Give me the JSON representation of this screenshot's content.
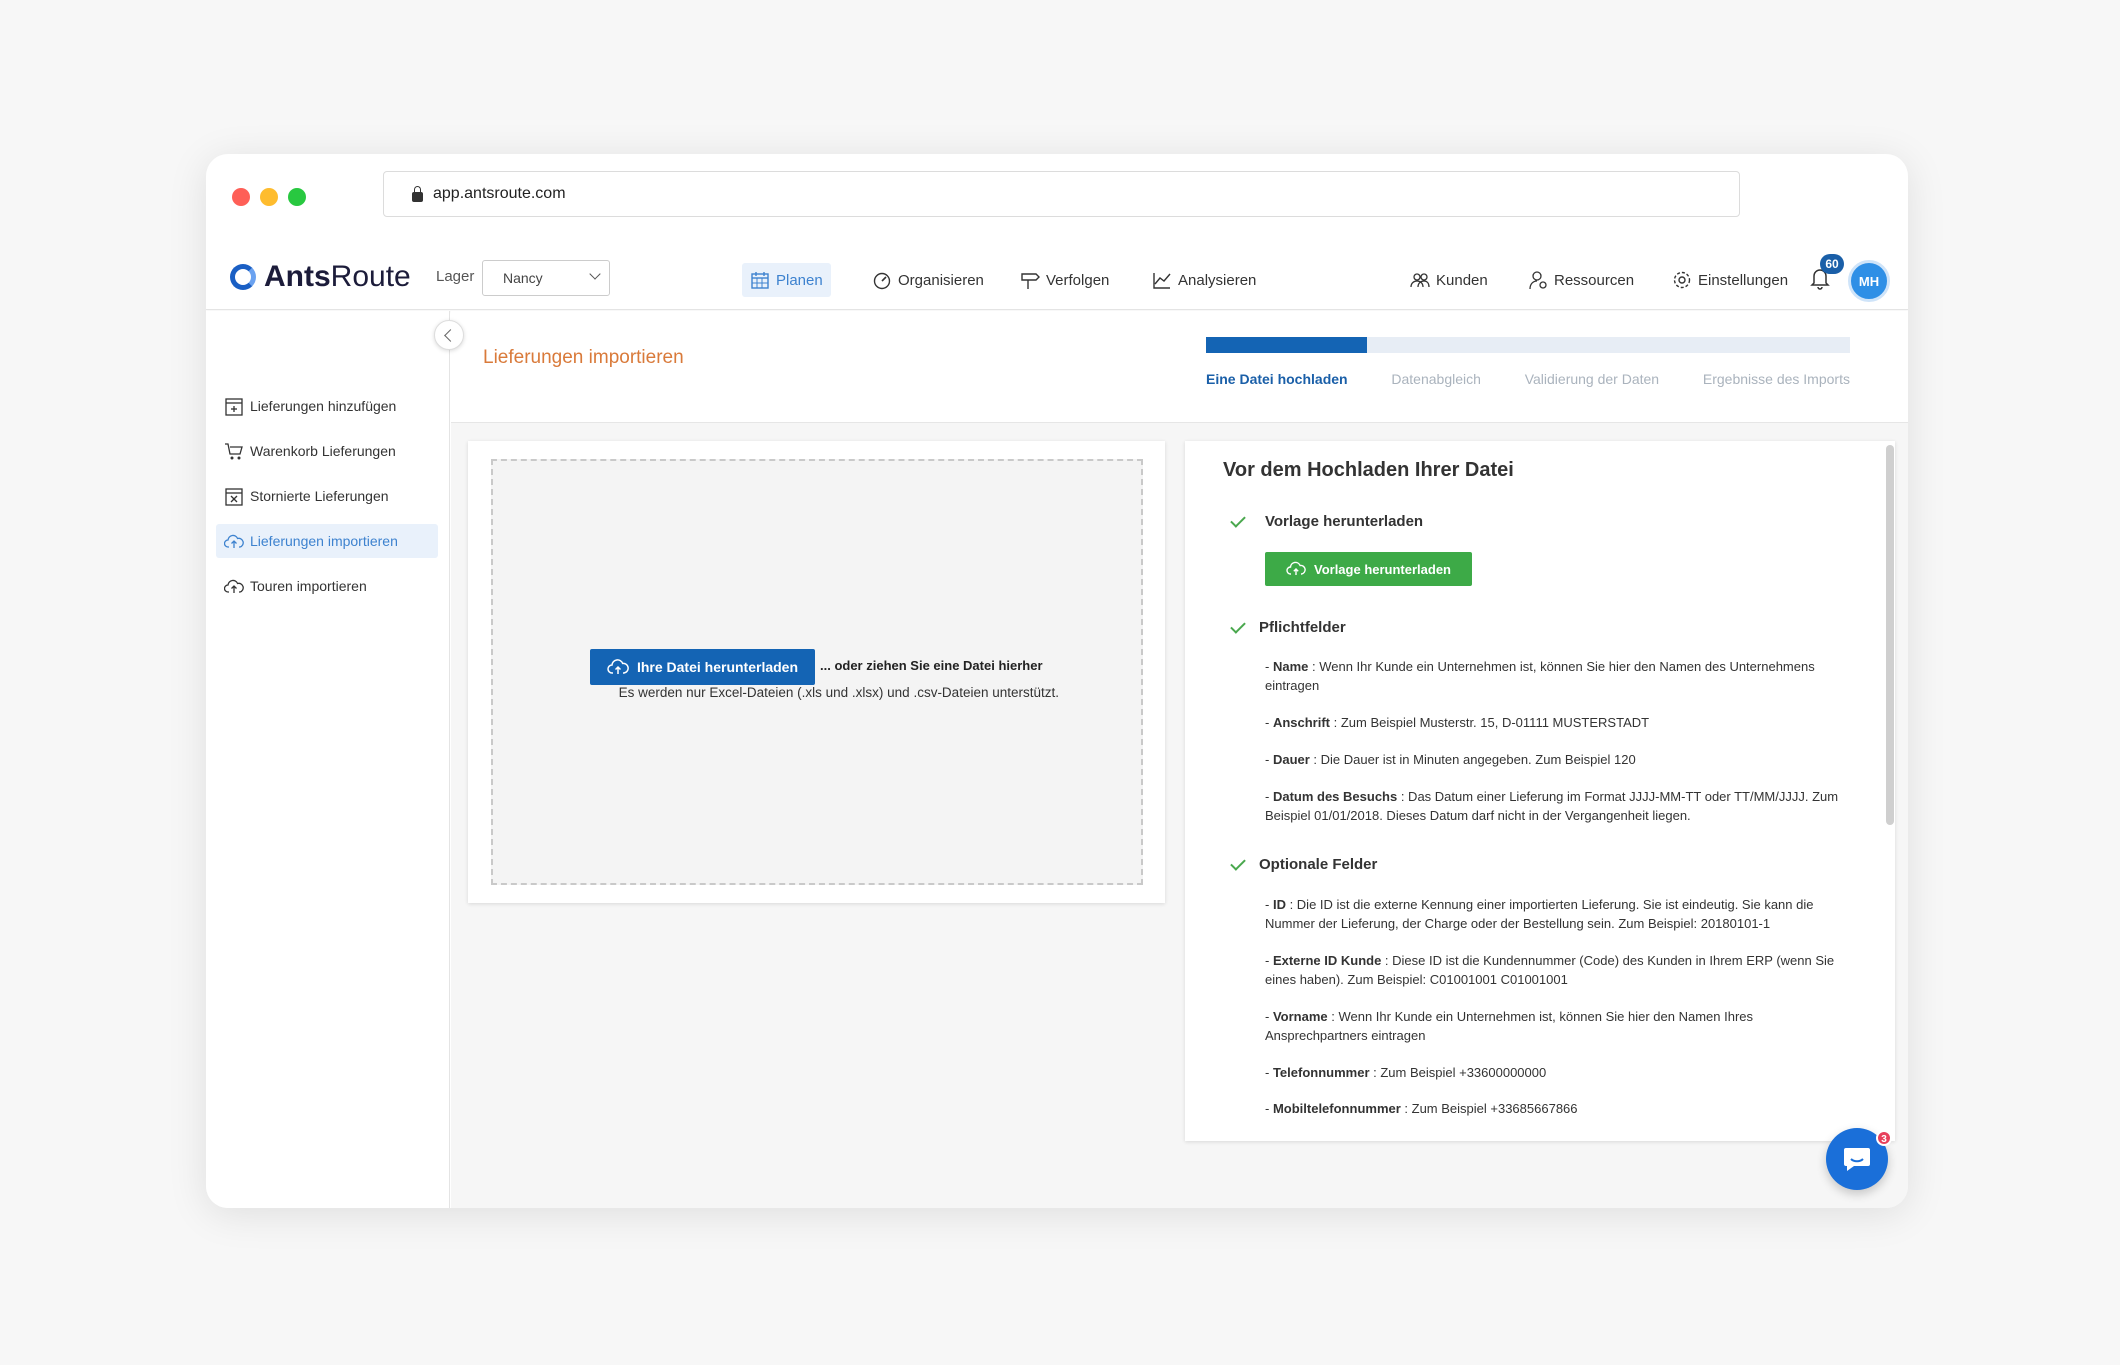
{
  "browser": {
    "url": "app.antsroute.com"
  },
  "header": {
    "logo_bold": "Ants",
    "logo_light": "Route",
    "lager_label": "Lager",
    "lager_value": "Nancy",
    "nav": [
      {
        "label": "Planen",
        "icon": "calendar-icon"
      },
      {
        "label": "Organisieren",
        "icon": "speedometer-icon"
      },
      {
        "label": "Verfolgen",
        "icon": "signpost-icon"
      },
      {
        "label": "Analysieren",
        "icon": "chart-icon"
      }
    ],
    "right_nav": [
      {
        "label": "Kunden",
        "icon": "customers-icon"
      },
      {
        "label": "Ressourcen",
        "icon": "resources-icon"
      },
      {
        "label": "Einstellungen",
        "icon": "gear-icon"
      }
    ],
    "notifications": "60",
    "avatar": "MH"
  },
  "sidebar": {
    "items": [
      {
        "label": "Lieferungen hinzufügen",
        "icon": "calendar-plus-icon"
      },
      {
        "label": "Warenkorb Lieferungen",
        "icon": "cart-icon"
      },
      {
        "label": "Stornierte Lieferungen",
        "icon": "calendar-x-icon"
      },
      {
        "label": "Lieferungen importieren",
        "icon": "cloud-upload-icon"
      },
      {
        "label": "Touren importieren",
        "icon": "cloud-upload-icon"
      }
    ]
  },
  "main": {
    "title": "Lieferungen importieren",
    "progress": 0.25,
    "steps": [
      "Eine Datei hochladen",
      "Datenabgleich",
      "Validierung der Daten",
      "Ergebnisse des Imports"
    ],
    "upload": {
      "button": "Ihre Datei herunterladen",
      "drop_text": "... oder ziehen Sie eine Datei hierher",
      "note": "Es werden nur Excel-Dateien (.xls und .xlsx) und .csv-Dateien unterstützt."
    },
    "info": {
      "title": "Vor dem Hochladen Ihrer Datei",
      "template_head": "Vorlage herunterladen",
      "template_button": "Vorlage herunterladen",
      "required_head": "Pflichtfelder",
      "required": [
        {
          "name": "Name",
          "text": " : Wenn Ihr Kunde ein Unternehmen ist, können Sie hier den Namen des Unternehmens eintragen"
        },
        {
          "name": "Anschrift",
          "text": " : Zum Beispiel Musterstr. 15, D-01111 MUSTERSTADT"
        },
        {
          "name": "Dauer",
          "text": " : Die Dauer ist in Minuten angegeben. Zum Beispiel 120"
        },
        {
          "name": "Datum des Besuchs",
          "text": " : Das Datum einer Lieferung im Format JJJJ-MM-TT oder TT/MM/JJJJ. Zum Beispiel 01/01/2018. Dieses Datum darf nicht in der Vergangenheit liegen."
        }
      ],
      "optional_head": "Optionale Felder",
      "optional": [
        {
          "name": "ID",
          "text": " : Die ID ist die externe Kennung einer importierten Lieferung. Sie ist eindeutig. Sie kann die Nummer der Lieferung, der Charge oder der Bestellung sein. Zum Beispiel: 20180101-1"
        },
        {
          "name": "Externe ID Kunde",
          "text": " : Diese ID ist die Kundennummer (Code) des Kunden in Ihrem ERP (wenn Sie eines haben). Zum Beispiel: C01001001 C01001001"
        },
        {
          "name": "Vorname",
          "text": " : Wenn Ihr Kunde ein Unternehmen ist, können Sie hier den Namen Ihres Ansprechpartners eintragen"
        },
        {
          "name": "Telefonnummer",
          "text": " : Zum Beispiel +33600000000"
        },
        {
          "name": "Mobiltelefonnummer",
          "text": " : Zum Beispiel +33685667866"
        }
      ]
    }
  },
  "chat": {
    "badge": "3"
  },
  "colors": {
    "primary": "#1464b4",
    "accent_orange": "#d97a3a",
    "success": "#3daa47"
  }
}
